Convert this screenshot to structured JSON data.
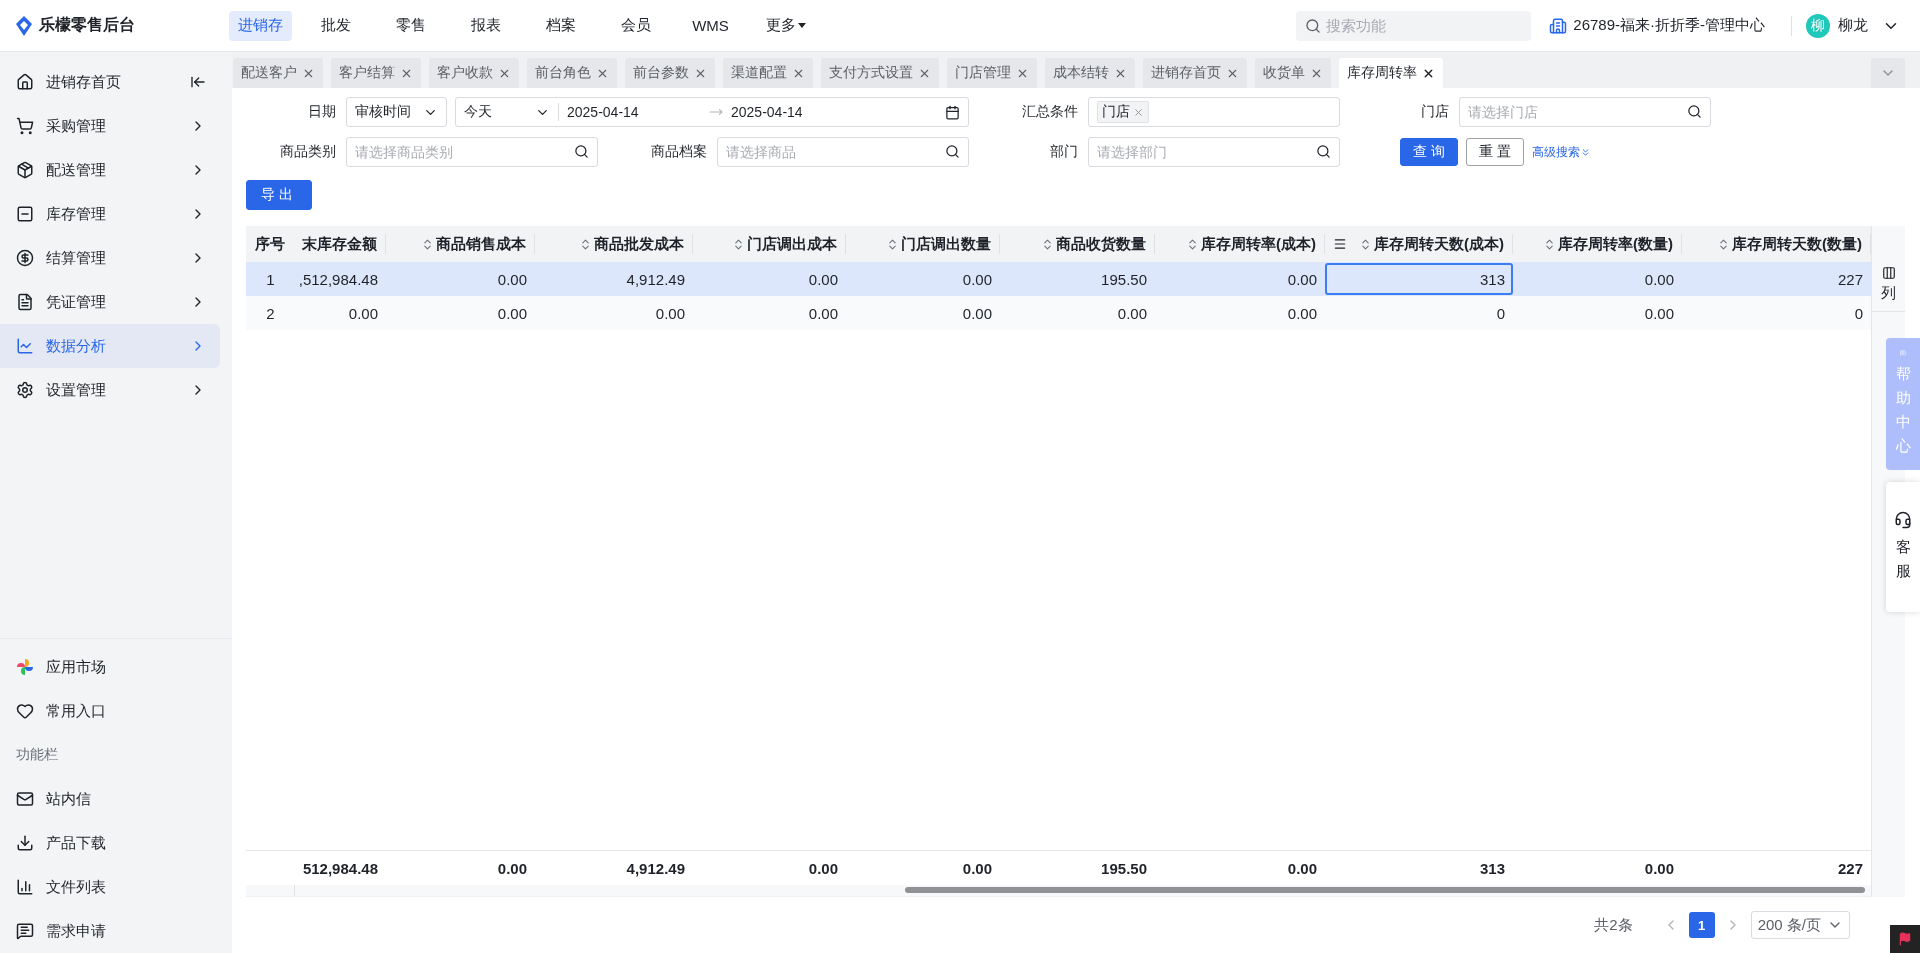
{
  "app": {
    "title": "乐檬零售后台"
  },
  "top_nav": [
    {
      "label": "进销存",
      "selected": true
    },
    {
      "label": "批发",
      "selected": false
    },
    {
      "label": "零售",
      "selected": false
    },
    {
      "label": "报表",
      "selected": false
    },
    {
      "label": "档案",
      "selected": false
    },
    {
      "label": "会员",
      "selected": false
    },
    {
      "label": "WMS",
      "selected": false
    },
    {
      "label": "更多",
      "selected": false,
      "dropdown": true
    }
  ],
  "header": {
    "search_placeholder": "搜索功能",
    "store": "26789-福来·折折季-管理中心",
    "avatar": "柳",
    "user": "柳龙"
  },
  "sidebar": {
    "items": [
      {
        "label": "进销存首页",
        "selected": false,
        "collapse": true
      },
      {
        "label": "采购管理",
        "selected": false,
        "collapse": false
      },
      {
        "label": "配送管理",
        "selected": false,
        "collapse": false
      },
      {
        "label": "库存管理",
        "selected": false,
        "collapse": false
      },
      {
        "label": "结算管理",
        "selected": false,
        "collapse": false
      },
      {
        "label": "凭证管理",
        "selected": false,
        "collapse": false
      },
      {
        "label": "数据分析",
        "selected": true,
        "collapse": false
      },
      {
        "label": "设置管理",
        "selected": false,
        "collapse": false
      }
    ],
    "bottom": [
      {
        "label": "应用市场",
        "kind": "link"
      },
      {
        "label": "常用入口",
        "kind": "link"
      },
      {
        "label": "功能栏",
        "kind": "section"
      },
      {
        "label": "站内信",
        "kind": "link"
      },
      {
        "label": "产品下载",
        "kind": "link"
      },
      {
        "label": "文件列表",
        "kind": "link"
      },
      {
        "label": "需求申请",
        "kind": "link"
      }
    ]
  },
  "tabs": [
    {
      "label": "配送客户",
      "selected": false
    },
    {
      "label": "客户结算",
      "selected": false
    },
    {
      "label": "客户收款",
      "selected": false
    },
    {
      "label": "前台角色",
      "selected": false
    },
    {
      "label": "前台参数",
      "selected": false
    },
    {
      "label": "渠道配置",
      "selected": false
    },
    {
      "label": "支付方式设置",
      "selected": false
    },
    {
      "label": "门店管理",
      "selected": false
    },
    {
      "label": "成本结转",
      "selected": false
    },
    {
      "label": "进销存首页",
      "selected": false
    },
    {
      "label": "收货单",
      "selected": false
    },
    {
      "label": "库存周转率",
      "selected": true
    }
  ],
  "filters": {
    "date": {
      "label": "日期",
      "type_value": "审核时间",
      "preset": "今天",
      "start": "2025-04-14",
      "end": "2025-04-14"
    },
    "summary": {
      "label": "汇总条件",
      "tags": [
        "门店"
      ]
    },
    "store": {
      "label": "门店",
      "placeholder": "请选择门店"
    },
    "category": {
      "label": "商品类别",
      "placeholder": "请选择商品类别"
    },
    "product": {
      "label": "商品档案",
      "placeholder": "请选择商品"
    },
    "department": {
      "label": "部门",
      "placeholder": "请选择部门"
    },
    "query_button": "查 询",
    "reset_button": "重 置",
    "advanced_link": "高级搜索"
  },
  "export_button": "导出",
  "table": {
    "columns": [
      {
        "label": "序号",
        "sortable": false,
        "focused": false
      },
      {
        "label": "末库存金额",
        "sortable": false,
        "focused": false
      },
      {
        "label": "商品销售成本",
        "sortable": true,
        "focused": false
      },
      {
        "label": "商品批发成本",
        "sortable": true,
        "focused": false
      },
      {
        "label": "门店调出成本",
        "sortable": true,
        "focused": false
      },
      {
        "label": "门店调出数量",
        "sortable": true,
        "focused": false
      },
      {
        "label": "商品收货数量",
        "sortable": true,
        "focused": false
      },
      {
        "label": "库存周转率(成本)",
        "sortable": true,
        "focused": false
      },
      {
        "label": "库存周转天数(成本)",
        "sortable": true,
        "focused": true
      },
      {
        "label": "库存周转率(数量)",
        "sortable": true,
        "focused": false
      },
      {
        "label": "库存周转天数(数量)",
        "sortable": true,
        "focused": false
      }
    ],
    "rows": [
      {
        "selected": true,
        "cells": [
          "1",
          ",512,984.48",
          "0.00",
          "4,912.49",
          "0.00",
          "0.00",
          "195.50",
          "0.00",
          "313",
          "0.00",
          "227"
        ]
      },
      {
        "selected": false,
        "cells": [
          "2",
          "0.00",
          "0.00",
          "0.00",
          "0.00",
          "0.00",
          "0.00",
          "0.00",
          "0",
          "0.00",
          "0"
        ]
      }
    ],
    "totals": [
      "512,984.48",
      "0.00",
      "4,912.49",
      "0.00",
      "0.00",
      "195.50",
      "0.00",
      "313",
      "0.00",
      "227"
    ],
    "column_settings": "列"
  },
  "pagination": {
    "total": "共2条",
    "pages": [
      {
        "label": "1",
        "selected": true
      }
    ],
    "page_size": "200 条/页"
  },
  "side_buttons": [
    {
      "label": "帮助中心",
      "kind": "help"
    },
    {
      "label": "客服",
      "kind": "service"
    }
  ]
}
